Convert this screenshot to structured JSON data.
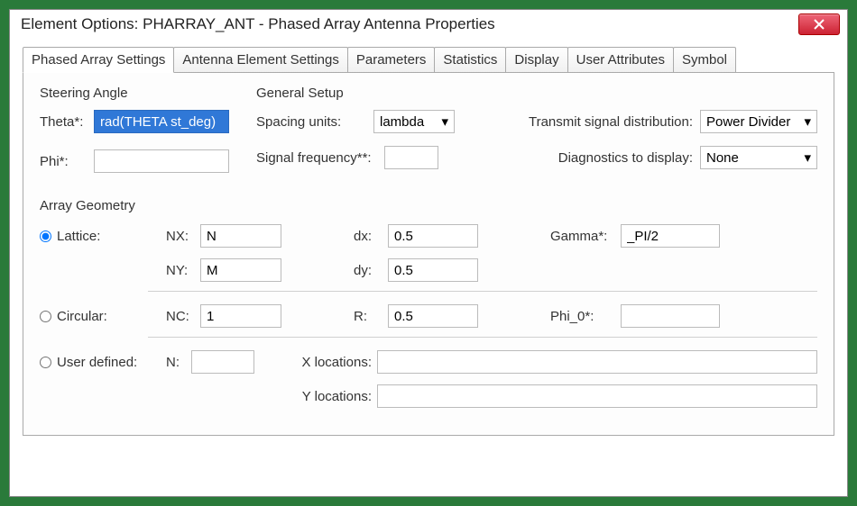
{
  "window": {
    "title": "Element Options: PHARRAY_ANT - Phased Array Antenna Properties"
  },
  "tabs": [
    "Phased Array Settings",
    "Antenna Element Settings",
    "Parameters",
    "Statistics",
    "Display",
    "User Attributes",
    "Symbol"
  ],
  "sections": {
    "steering": {
      "title": "Steering Angle",
      "theta_label": "Theta*:",
      "theta_value": "rad(THETA st_deg)",
      "phi_label": "Phi*:",
      "phi_value": ""
    },
    "general": {
      "title": "General Setup",
      "spacing_label": "Spacing units:",
      "spacing_value": "lambda",
      "signal_freq_label": "Signal frequency**:",
      "signal_freq_value": "",
      "tx_dist_label": "Transmit signal distribution:",
      "tx_dist_value": "Power Divider",
      "diagnostics_label": "Diagnostics to display:",
      "diagnostics_value": "None"
    },
    "array_geom": {
      "title": "Array Geometry",
      "lattice": {
        "label": "Lattice:",
        "nx_label": "NX:",
        "nx_value": "N",
        "dx_label": "dx:",
        "dx_value": "0.5",
        "gamma_label": "Gamma*:",
        "gamma_value": "_PI/2",
        "ny_label": "NY:",
        "ny_value": "M",
        "dy_label": "dy:",
        "dy_value": "0.5"
      },
      "circular": {
        "label": "Circular:",
        "nc_label": "NC:",
        "nc_value": "1",
        "r_label": "R:",
        "r_value": "0.5",
        "phi0_label": "Phi_0*:",
        "phi0_value": ""
      },
      "user_defined": {
        "label": "User defined:",
        "n_label": "N:",
        "n_value": "",
        "xloc_label": "X locations:",
        "xloc_value": "",
        "yloc_label": "Y locations:",
        "yloc_value": ""
      }
    }
  }
}
